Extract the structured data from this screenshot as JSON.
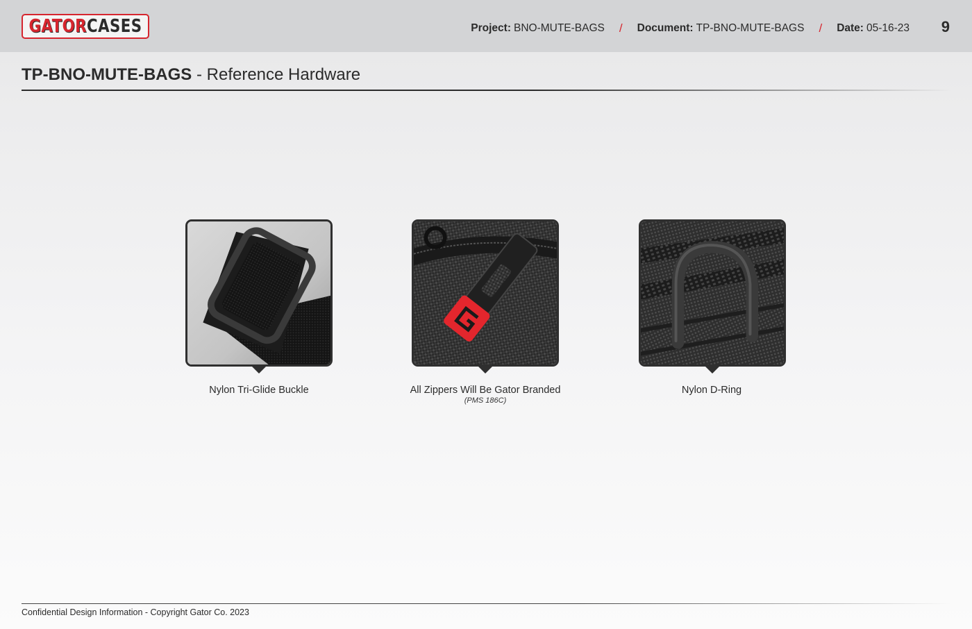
{
  "header": {
    "logo_left": "GATOR",
    "logo_right": "CASES",
    "project_label": "Project:",
    "project_value": "BNO-MUTE-BAGS",
    "document_label": "Document:",
    "document_value": "TP-BNO-MUTE-BAGS",
    "date_label": "Date:",
    "date_value": "05-16-23",
    "separator": "/",
    "page_number": "9"
  },
  "title": {
    "code": "TP-BNO-MUTE-BAGS",
    "rest": " - Reference Hardware"
  },
  "items": [
    {
      "caption": "Nylon Tri-Glide Buckle",
      "image_icon": "tri-glide-buckle-photo"
    },
    {
      "caption": "All Zippers Will Be Gator Branded",
      "subcaption": "(PMS 186C)",
      "image_icon": "gator-zipper-pull-photo"
    },
    {
      "caption": "Nylon D-Ring",
      "image_icon": "d-ring-photo"
    }
  ],
  "footer": {
    "text": "Confidential Design Information - Copyright Gator Co. 2023"
  },
  "colors": {
    "brand_red": "#d6252e",
    "dark": "#2b2b2b",
    "header_bg": "#d3d4d6"
  }
}
